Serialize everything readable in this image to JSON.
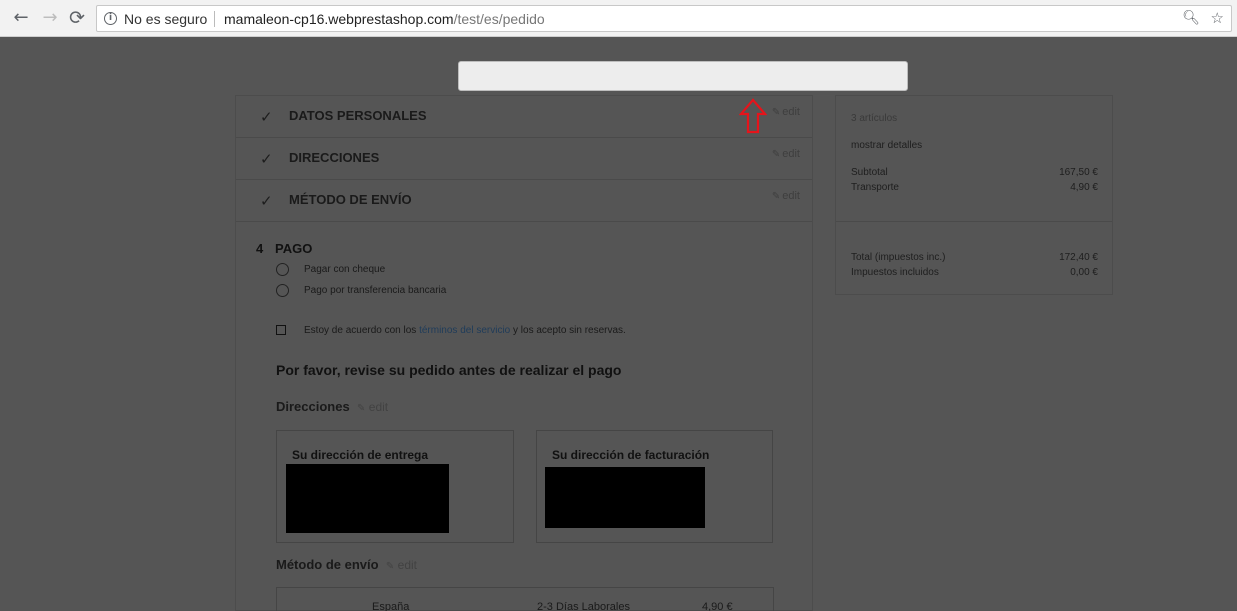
{
  "browser": {
    "security_text": "No es seguro",
    "url_host": "mamaleon-cp16.webprestashop.com",
    "url_path": "/test/es/pedido",
    "icons": [
      "back-icon",
      "forward-icon",
      "reload-icon",
      "info-icon",
      "zoom-icon",
      "star-icon"
    ]
  },
  "checkout": {
    "steps": [
      {
        "title": "DATOS PERSONALES",
        "edit": "edit"
      },
      {
        "title": "DIRECCIONES",
        "edit": "edit"
      },
      {
        "title": "MÉTODO DE ENVÍO",
        "edit": "edit"
      }
    ],
    "payment": {
      "number": "4",
      "title": "PAGO",
      "options": [
        "Pagar con cheque",
        "Pago por transferencia bancaria"
      ],
      "terms_before": "Estoy de acuerdo con los ",
      "terms_link": "términos del servicio",
      "terms_after": " y los acepto sin reservas."
    },
    "review_title": "Por favor, revise su pedido antes de realizar el pago",
    "addresses_heading": "Direcciones",
    "addresses_edit": "edit",
    "delivery_address_title": "Su dirección de entrega",
    "billing_address_title": "Su dirección de facturación",
    "shipping_heading": "Método de envío",
    "shipping_edit": "edit",
    "shipping_row": {
      "carrier": "España",
      "delay": "2-3 Días Laborales",
      "price": "4,90 €"
    }
  },
  "summary": {
    "items_count": "3 artículos",
    "show_details": "mostrar detalles",
    "subtotal_label": "Subtotal",
    "subtotal_value": "167,50 €",
    "shipping_label": "Transporte",
    "shipping_value": "4,90 €",
    "total_label": "Total (impuestos inc.)",
    "total_value": "172,40 €",
    "taxes_label": "Impuestos incluidos",
    "taxes_value": "0,00 €"
  },
  "colors": {
    "page_overlay": "#555555",
    "link": "#1f3c5a",
    "arrow": "#e5141b"
  }
}
